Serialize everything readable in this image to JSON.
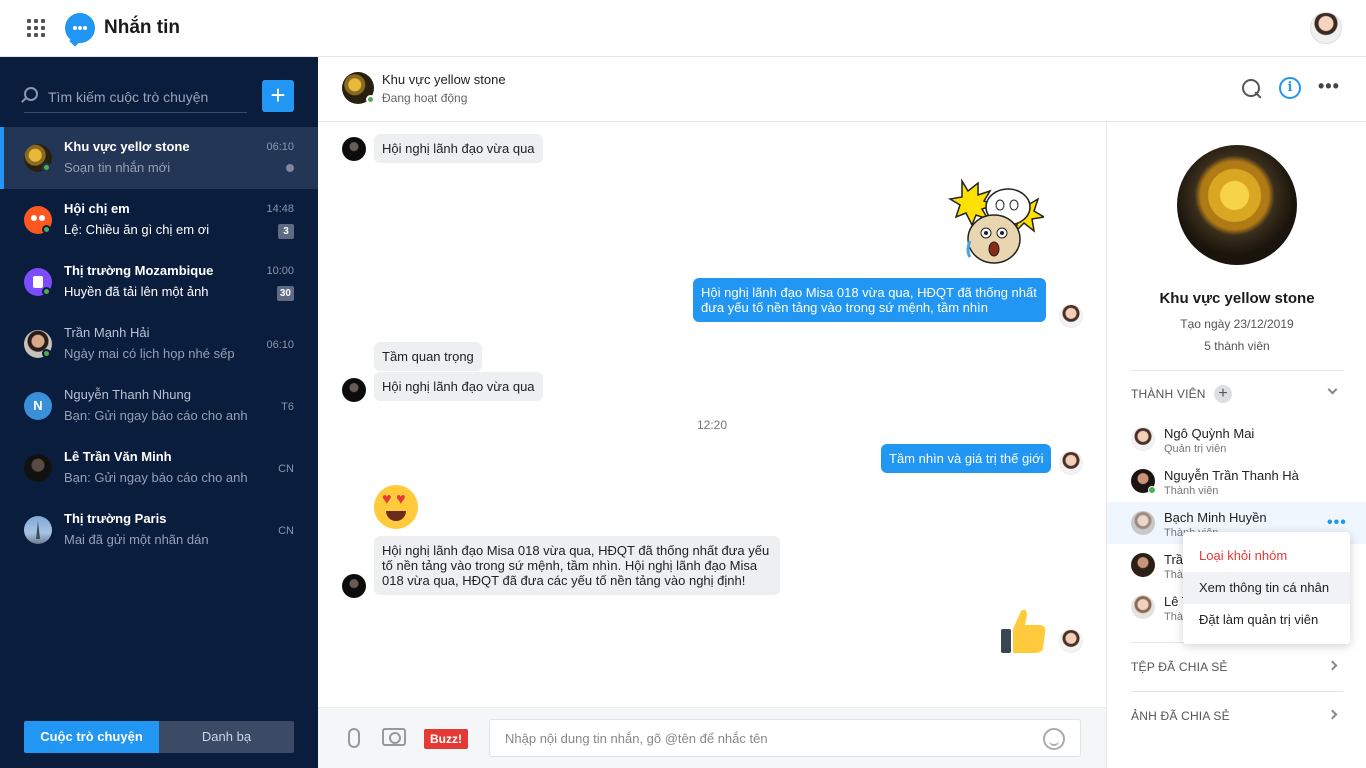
{
  "app": {
    "title": "Nhắn tin"
  },
  "icons": {
    "apps": "grid-icon",
    "logo": "chat-bubble-icon",
    "search": "search-icon",
    "add": "plus-icon",
    "info": "info-icon",
    "more": "more-horizontal-icon",
    "attach": "paperclip-icon",
    "camera": "camera-icon",
    "emoji": "smile-icon"
  },
  "colors": {
    "accent": "#2196f3",
    "sidebar": "#0a1d3d",
    "danger": "#e53935",
    "online": "#4caf50"
  },
  "sidebar": {
    "search_placeholder": "Tìm kiếm cuộc trò chuyện",
    "new_button": "+",
    "conversations": [
      {
        "name": "Khu vực yellơ stone",
        "preview": "Soạn tin nhắn mới",
        "time": "06:10"
      },
      {
        "name": "Hội chị em",
        "preview": "Lệ: Chiều ăn gì chị em ơi",
        "time": "14:48",
        "badge": "3"
      },
      {
        "name": "Thị trường Mozambique",
        "preview": "Huyền đã tải lên một ảnh",
        "time": "10:00",
        "badge": "30"
      },
      {
        "name": "Trần Mạnh Hải",
        "preview": "Ngày mai có lịch họp nhé sếp",
        "time": "06:10"
      },
      {
        "name": "Nguyễn Thanh Nhung",
        "preview": "Bạn: Gửi ngay báo cáo cho anh",
        "time": "T6",
        "initial": "N"
      },
      {
        "name": "Lê Trần Văn Minh",
        "preview": "Bạn: Gửi ngay báo cáo cho anh",
        "time": "CN"
      },
      {
        "name": "Thị trường Paris",
        "preview": "Mai đã gửi một nhãn dán",
        "time": "CN"
      }
    ],
    "tabs": {
      "chats": "Cuộc trò chuyện",
      "contacts": "Danh bạ"
    }
  },
  "chat": {
    "title": "Khu vực yellow stone",
    "status": "Đang hoạt động",
    "messages": {
      "m1": "Hội nghị lãnh đạo vừa qua",
      "m2": "Hội nghị lãnh đạo Misa 018 vừa qua, HĐQT đã thống nhất đưa yếu tố nền tảng vào trong sứ mệnh, tầm nhìn",
      "m3": "Tầm quan trọng",
      "m4": "Hội nghị lãnh đạo vừa qua",
      "time_sep": "12:20",
      "m5": "Tầm nhìn và giá trị thế giới",
      "m6": "Hội nghị lãnh đạo Misa 018 vừa qua, HĐQT đã thống nhất đưa yếu tố nền tảng vào trong sứ mệnh, tầm nhìn. Hội nghị lãnh đạo Misa 018 vừa qua, HĐQT đã đưa các yếu tố nền tảng vào nghị định!"
    },
    "composer": {
      "placeholder": "Nhập nội dung tin nhắn, gõ @tên để nhắc tên",
      "buzz": "Buzz!"
    }
  },
  "details": {
    "name": "Khu vực yellow stone",
    "created": "Tạo ngày 23/12/2019",
    "member_count": "5 thành viên",
    "members_title": "THÀNH VIÊN",
    "members": [
      {
        "name": "Ngô Quỳnh Mai",
        "role": "Quản trị viên"
      },
      {
        "name": "Nguyễn Trần Thanh Hà",
        "role": "Thành viên"
      },
      {
        "name": "Bạch Minh Huyền",
        "role": "Thành viên"
      },
      {
        "name": "Trầ",
        "role": "Thà"
      },
      {
        "name": "Lê T",
        "role": "Thà"
      }
    ],
    "shared_files": "TỆP ĐÃ CHIA SẺ",
    "shared_photos": "ẢNH ĐÃ CHIA SẺ"
  },
  "context_menu": {
    "remove": "Loại khỏi nhóm",
    "view_profile": "Xem thông tin cá nhân",
    "make_admin": "Đặt làm quản trị viên"
  }
}
